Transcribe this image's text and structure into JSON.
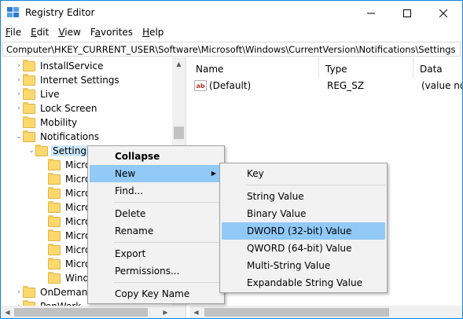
{
  "window": {
    "title": "Registry Editor"
  },
  "menubar": [
    {
      "accel": "F",
      "rest": "ile"
    },
    {
      "accel": "E",
      "rest": "dit"
    },
    {
      "accel": "V",
      "rest": "iew"
    },
    {
      "accel": "F",
      "rest": "avorites",
      "prefix": ""
    },
    {
      "accel": "H",
      "rest": "elp"
    }
  ],
  "address": "Computer\\HKEY_CURRENT_USER\\Software\\Microsoft\\Windows\\CurrentVersion\\Notifications\\Settings",
  "tree": {
    "items": [
      {
        "label": "InstallService"
      },
      {
        "label": "Internet Settings"
      },
      {
        "label": "Live"
      },
      {
        "label": "Lock Screen"
      },
      {
        "label": "Mobility"
      },
      {
        "label": "Notifications"
      },
      {
        "label": "Settings"
      },
      {
        "label": "Micro"
      },
      {
        "label": "Micro"
      },
      {
        "label": "Micro"
      },
      {
        "label": "Micro"
      },
      {
        "label": "Micro"
      },
      {
        "label": "Micro"
      },
      {
        "label": "Micro"
      },
      {
        "label": "Micro"
      },
      {
        "label": "Windo"
      },
      {
        "label": "OnDemand"
      },
      {
        "label": "PenWork"
      }
    ]
  },
  "list": {
    "columns": [
      "Name",
      "Type",
      "Data"
    ],
    "rows": [
      {
        "name": "(Default)",
        "type": "REG_SZ",
        "data": "(value not"
      }
    ]
  },
  "context_menu": {
    "items": [
      "Collapse",
      "New",
      "Find...",
      "Delete",
      "Rename",
      "Export",
      "Permissions...",
      "Copy Key Name"
    ]
  },
  "submenu": {
    "items": [
      "Key",
      "String Value",
      "Binary Value",
      "DWORD (32-bit) Value",
      "QWORD (64-bit) Value",
      "Multi-String Value",
      "Expandable String Value"
    ]
  },
  "colors": {
    "highlight": "#91c9f7",
    "selection": "#cce8ff",
    "border": "#1883d7",
    "folder": "#fdd86d"
  }
}
